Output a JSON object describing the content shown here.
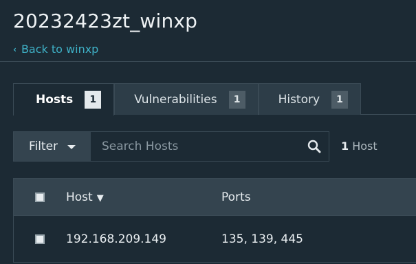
{
  "header": {
    "title": "20232423zt_winxp",
    "back_label": "Back to winxp"
  },
  "tabs": [
    {
      "label": "Hosts",
      "count": "1",
      "active": true
    },
    {
      "label": "Vulnerabilities",
      "count": "1",
      "active": false
    },
    {
      "label": "History",
      "count": "1",
      "active": false
    }
  ],
  "filter": {
    "button_label": "Filter",
    "search_placeholder": "Search Hosts",
    "result_count": "1",
    "result_label": "Host"
  },
  "table": {
    "columns": [
      "Host",
      "Ports"
    ],
    "sort_indicator": "▼",
    "rows": [
      {
        "host": "192.168.209.149",
        "ports": "135, 139, 445"
      }
    ]
  },
  "colors": {
    "background": "#1c2a34",
    "accent": "#3fb3c9",
    "panel": "#34444f"
  },
  "icons": {
    "back": "chevron-left-icon",
    "filter_dropdown": "caret-down-icon",
    "search": "search-icon"
  }
}
